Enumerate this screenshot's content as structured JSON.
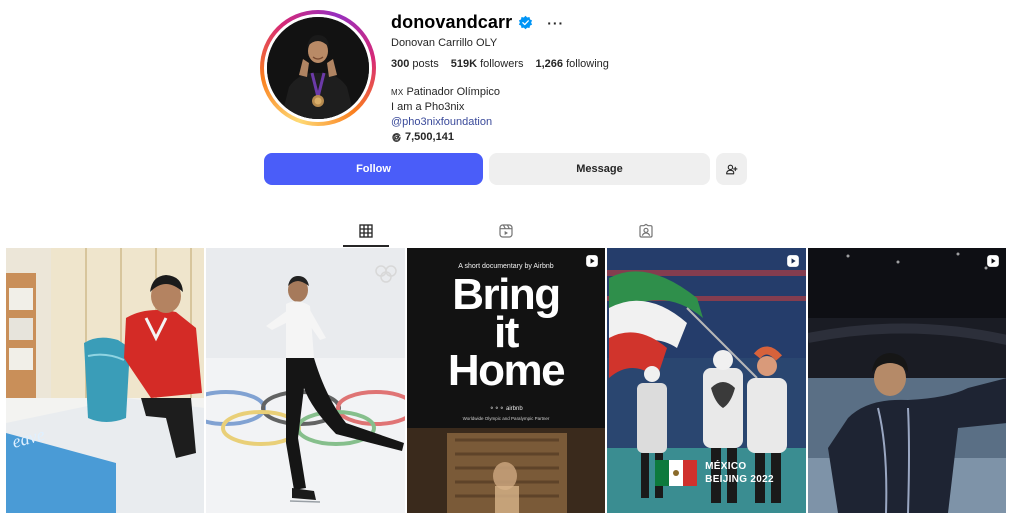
{
  "profile": {
    "username": "donovandcarr",
    "more_icon": "more-horizontal-icon",
    "full_name": "Donovan Carrillo OLY",
    "stats": [
      {
        "value": "300",
        "label": "posts"
      },
      {
        "value": "519K",
        "label": "followers"
      },
      {
        "value": "1,266",
        "label": "following"
      }
    ],
    "bio": {
      "flag_code": "MX",
      "line1": "Patinador Olímpico",
      "line2": "I am a Pho3nix",
      "link": "@pho3nixfoundation",
      "threads_count": "7,500,141"
    }
  },
  "actions": {
    "follow": "Follow",
    "message": "Message",
    "suggest_icon": "add-person-icon"
  },
  "tabs": [
    {
      "name": "posts",
      "icon": "grid-icon",
      "active": true
    },
    {
      "name": "reels",
      "icon": "reels-icon",
      "active": false
    },
    {
      "name": "tagged",
      "icon": "tagged-icon",
      "active": false
    }
  ],
  "posts": [
    {
      "type": "image",
      "text": ""
    },
    {
      "type": "image",
      "text": ""
    },
    {
      "type": "reel",
      "top_text": "A short documentary by Airbnb",
      "title_lines": [
        "Bring",
        "it",
        "Home"
      ],
      "logos": "airbnb",
      "partner": "Worldwide Olympic and Paralympic Partner"
    },
    {
      "type": "reel",
      "caption_lines": [
        "MÉXICO",
        "BEIJING 2022"
      ]
    },
    {
      "type": "reel",
      "text": ""
    }
  ],
  "colors": {
    "follow_button": "#4a5df9",
    "secondary_button": "#efefef",
    "verified": "#0095f6"
  }
}
